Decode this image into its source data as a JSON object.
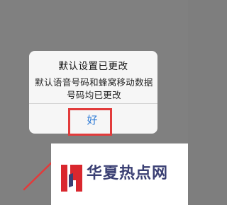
{
  "dialog": {
    "title": "默认设置已更改",
    "message": "默认语音号码和蜂窝移动数据号码均已更改",
    "ok_label": "好"
  },
  "watermark": {
    "text": "华夏热点网",
    "logo_icon": "brand-h-logo-icon"
  },
  "colors": {
    "backdrop": "#808080",
    "dialog_bg": "#f6f6f6",
    "button_text": "#2e7bd6",
    "highlight": "#e23b3b",
    "logo_red": "#d9272e",
    "logo_navy": "#3a3f73"
  }
}
